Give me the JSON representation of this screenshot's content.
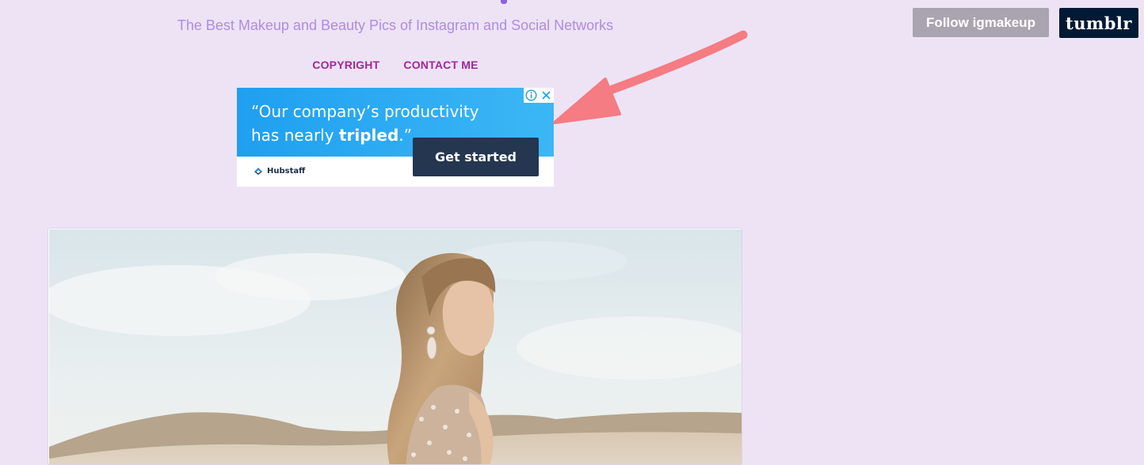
{
  "header": {
    "subtitle": "The Best Makeup and Beauty Pics of Instagram and Social Networks"
  },
  "nav": {
    "items": [
      {
        "label": "COPYRIGHT"
      },
      {
        "label": "CONTACT ME"
      }
    ]
  },
  "tumblr_controls": {
    "follow_label": "Follow igmakeup",
    "tumblr_label": "tumblr"
  },
  "ad": {
    "quote_part1": "“Our company’s productivity has nearly ",
    "quote_bold": "tripled",
    "quote_part2": ".”",
    "cta_label": "Get started",
    "brand": "Hubstaff",
    "icons": [
      "info-icon",
      "close-icon"
    ]
  },
  "colors": {
    "background": "#ede3f5",
    "subtitle": "#b08be0",
    "nav_link": "#a0289c",
    "follow_button": "#aaa3b0",
    "tumblr_button": "#001935",
    "ad_blue": "#1f9ff0",
    "ad_cta": "#243650",
    "arrow": "#f47c82"
  },
  "post": {
    "image": "photo of blonde woman in sequined gown on sand dunes"
  }
}
